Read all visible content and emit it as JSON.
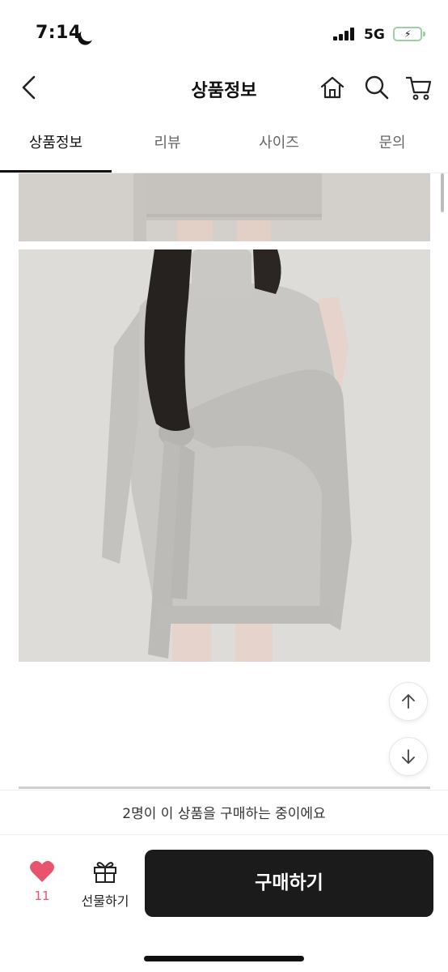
{
  "status_bar": {
    "time": "7:14",
    "network": "5G",
    "icons": [
      "moon-icon",
      "signal-icon",
      "battery-charging-icon"
    ]
  },
  "header": {
    "title": "상품정보",
    "icons": [
      "back-chevron-icon",
      "home-icon",
      "search-icon",
      "cart-icon"
    ]
  },
  "tabs": [
    {
      "label": "상품정보",
      "active": true
    },
    {
      "label": "리뷰",
      "active": false
    },
    {
      "label": "사이즈",
      "active": false
    },
    {
      "label": "문의",
      "active": false
    }
  ],
  "content": {
    "images": [
      "product-photo-top-crop",
      "product-photo-grey-knit-dress",
      "product-photo-next"
    ],
    "icons": [
      "arrow-up-icon",
      "arrow-down-icon"
    ]
  },
  "notice": {
    "text": "2명이 이 상품을 구매하는 중이에요"
  },
  "actions": {
    "like_count": "11",
    "gift_label": "선물하기",
    "buy_label": "구매하기"
  },
  "colors": {
    "accent_heart": "#e8546e",
    "buy_button": "#1b1b1b",
    "battery": "#59c769"
  }
}
